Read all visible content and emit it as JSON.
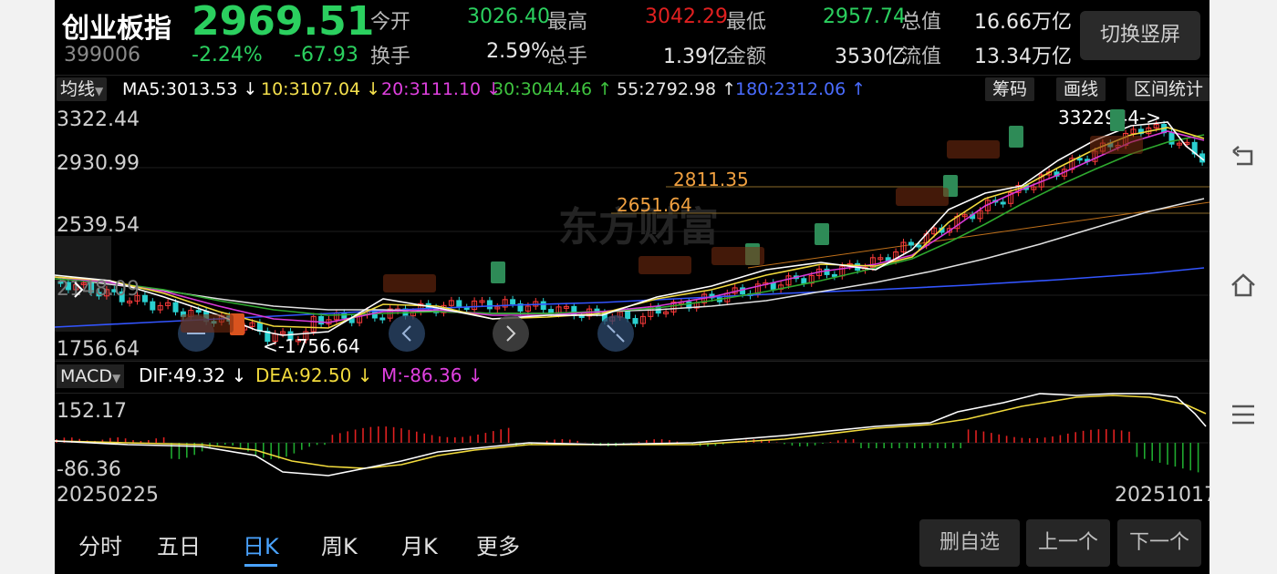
{
  "header": {
    "name": "创业板指",
    "price": "2969.51",
    "code": "399006",
    "change_pct": "-2.24%",
    "change_val": "-67.93",
    "quotes": [
      {
        "label": "今开",
        "value": "3026.40",
        "color": "#2bd05f"
      },
      {
        "label": "最高",
        "value": "3042.29",
        "color": "#e02020"
      },
      {
        "label": "最低",
        "value": "2957.74",
        "color": "#2bd05f"
      },
      {
        "label": "总值",
        "value": "16.66万亿",
        "color": "#e8e8e8"
      },
      {
        "label": "换手",
        "value": "2.59%",
        "color": "#e8e8e8"
      },
      {
        "label": "总手",
        "value": "1.39亿",
        "color": "#e8e8e8"
      },
      {
        "label": "金额",
        "value": "3530亿",
        "color": "#e8e8e8"
      },
      {
        "label": "流值",
        "value": "13.34万亿",
        "color": "#e8e8e8"
      }
    ],
    "switch_label": "切换竖屏"
  },
  "toolbar": {
    "ma_dropdown": "均线",
    "indicators": [
      {
        "text": "MA5:3013.53 ↓",
        "color": "#ffffff"
      },
      {
        "text": "10:3107.04 ↓",
        "color": "#f4e04d"
      },
      {
        "text": "20:3111.10 ↓",
        "color": "#e040e0"
      },
      {
        "text": "30:3044.46 ↑",
        "color": "#3fc33f"
      },
      {
        "text": "55:2792.98 ↑",
        "color": "#e8e8e8"
      },
      {
        "text": "180:2312.06 ↑",
        "color": "#4a6cff"
      }
    ],
    "buttons": [
      "筹码",
      "画线",
      "区间统计"
    ]
  },
  "main_axis": [
    "3322.44",
    "2930.99",
    "2539.54",
    "2148.09",
    "1756.64"
  ],
  "annotations": {
    "high_label": "3322944->",
    "low_label": "<-1756.64",
    "level1": "2811.35",
    "level2": "2651.64"
  },
  "watermark": "东方财富",
  "macd": {
    "label": "MACD",
    "dif": "DIF:49.32 ↓",
    "dea": "DEA:92.50 ↓",
    "m": "M:-86.36 ↓",
    "axis_top": "152.17",
    "axis_bottom": "-86.36"
  },
  "dates": {
    "start": "20250225",
    "end": "20251017"
  },
  "tabs": [
    "分时",
    "五日",
    "日K",
    "周K",
    "月K",
    "更多"
  ],
  "active_tab": "日K",
  "buttons": {
    "remove": "删自选",
    "prev": "上一个",
    "next": "下一个"
  },
  "chart_data": {
    "type": "line",
    "title": "",
    "x": [
      "20250225",
      "20251017"
    ],
    "ylim": [
      1756.64,
      3322.44
    ],
    "high": 3322.44,
    "low": 1756.64,
    "last_close": 2969.51,
    "moving_averages": [
      {
        "name": "MA5",
        "value": 3013.53
      },
      {
        "name": "MA10",
        "value": 3107.04
      },
      {
        "name": "MA20",
        "value": 3111.1
      },
      {
        "name": "MA30",
        "value": 3044.46
      },
      {
        "name": "MA55",
        "value": 2792.98
      },
      {
        "name": "MA180",
        "value": 2312.06
      }
    ],
    "macd": {
      "DIF": 49.32,
      "DEA": 92.5,
      "M": -86.36,
      "ylim": [
        -86.36,
        152.17
      ]
    }
  }
}
